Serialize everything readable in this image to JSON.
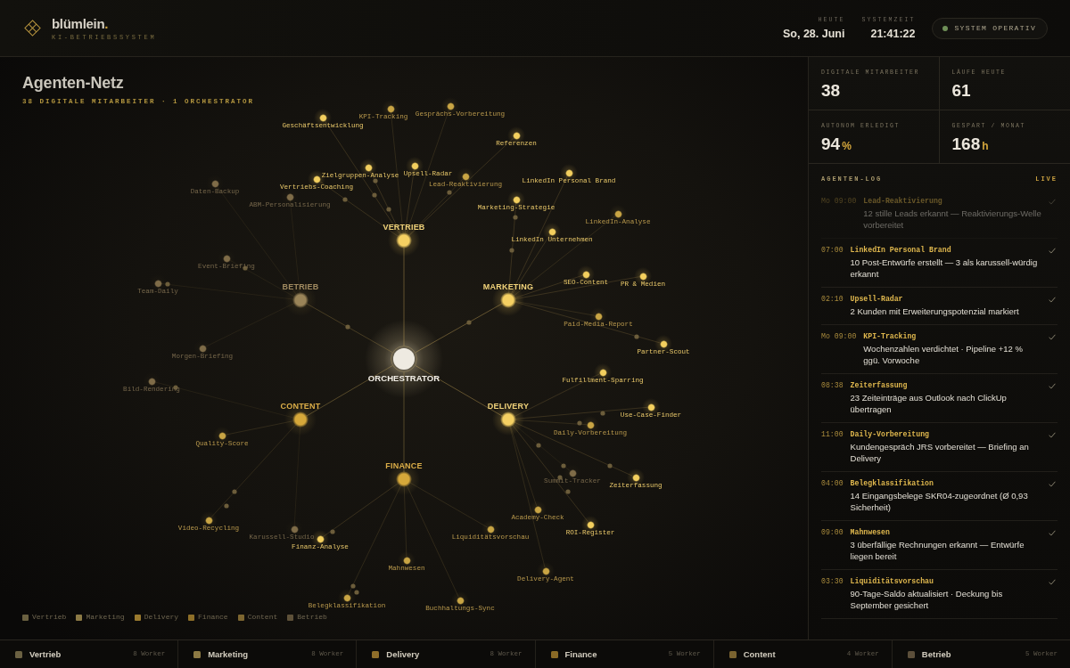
{
  "header": {
    "brand": {
      "name": "blümlein",
      "dot": "."
    },
    "tagline": "KI-BETRIEBSSYSTEM",
    "date_label": "HEUTE",
    "date": "So, 28. Juni",
    "time_label": "SYSTEMZEIT",
    "time": "21:41:22",
    "status": "SYSTEM OPERATIV"
  },
  "network": {
    "title": "Agenten-Netz",
    "subtitle": "38 DIGITALE MITARBEITER · 1 ORCHESTRATOR",
    "orchestrator": "ORCHESTRATOR",
    "hubs": [
      {
        "label": "VERTRIEB",
        "active": true,
        "dimmed": false,
        "agents": [
          {
            "label": "Geschäftsentwicklung",
            "active": true,
            "dimmed": false
          },
          {
            "label": "KPI-Tracking",
            "active": false,
            "dimmed": false
          },
          {
            "label": "Gesprächs-Vorbereitung",
            "active": false,
            "dimmed": false
          },
          {
            "label": "Referenzen",
            "active": true,
            "dimmed": false
          },
          {
            "label": "Zielgruppen-Analyse",
            "active": true,
            "dimmed": false
          },
          {
            "label": "Upsell-Radar",
            "active": true,
            "dimmed": false
          },
          {
            "label": "Vertriebs-Coaching",
            "active": true,
            "dimmed": false
          },
          {
            "label": "Lead-Reaktivierung",
            "active": false,
            "dimmed": false
          }
        ]
      },
      {
        "label": "BETRIEB",
        "active": false,
        "dimmed": true,
        "agents": [
          {
            "label": "Daten-Backup",
            "active": false,
            "dimmed": true
          },
          {
            "label": "ABM-Personalisierung",
            "active": false,
            "dimmed": true
          },
          {
            "label": "Event-Briefing",
            "active": false,
            "dimmed": true
          },
          {
            "label": "Team-Daily",
            "active": false,
            "dimmed": true
          },
          {
            "label": "Morgen-Briefing",
            "active": false,
            "dimmed": true
          }
        ]
      },
      {
        "label": "MARKETING",
        "active": true,
        "dimmed": false,
        "agents": [
          {
            "label": "LinkedIn Personal Brand",
            "active": true,
            "dimmed": false
          },
          {
            "label": "Marketing-Strategie",
            "active": true,
            "dimmed": false
          },
          {
            "label": "LinkedIn-Analyse",
            "active": false,
            "dimmed": false
          },
          {
            "label": "LinkedIn Unternehmen",
            "active": true,
            "dimmed": false
          },
          {
            "label": "SEO-Content",
            "active": true,
            "dimmed": false
          },
          {
            "label": "PR & Medien",
            "active": true,
            "dimmed": false
          },
          {
            "label": "Paid-Media-Report",
            "active": false,
            "dimmed": false
          },
          {
            "label": "Partner-Scout",
            "active": true,
            "dimmed": false
          }
        ]
      },
      {
        "label": "CONTENT",
        "active": false,
        "dimmed": false,
        "agents": [
          {
            "label": "Bild-Rendering",
            "active": false,
            "dimmed": true
          },
          {
            "label": "Quality-Score",
            "active": false,
            "dimmed": false
          },
          {
            "label": "Video-Recycling",
            "active": false,
            "dimmed": false
          },
          {
            "label": "Karussell-Studio",
            "active": false,
            "dimmed": true
          }
        ]
      },
      {
        "label": "DELIVERY",
        "active": true,
        "dimmed": false,
        "agents": [
          {
            "label": "Fulfillment-Sparring",
            "active": true,
            "dimmed": false
          },
          {
            "label": "Use-Case-Finder",
            "active": true,
            "dimmed": false
          },
          {
            "label": "Daily-Vorbereitung",
            "active": false,
            "dimmed": false
          },
          {
            "label": "Summit-Tracker",
            "active": false,
            "dimmed": true
          },
          {
            "label": "Zeiterfassung",
            "active": true,
            "dimmed": false
          },
          {
            "label": "Academy-Check",
            "active": false,
            "dimmed": false
          },
          {
            "label": "ROI-Register",
            "active": true,
            "dimmed": false
          },
          {
            "label": "Delivery-Agent",
            "active": false,
            "dimmed": false
          }
        ]
      },
      {
        "label": "FINANCE",
        "active": false,
        "dimmed": false,
        "agents": [
          {
            "label": "Liquiditätsvorschau",
            "active": false,
            "dimmed": false
          },
          {
            "label": "Finanz-Analyse",
            "active": true,
            "dimmed": false
          },
          {
            "label": "Mahnwesen",
            "active": false,
            "dimmed": false
          },
          {
            "label": "Buchhaltungs-Sync",
            "active": false,
            "dimmed": false
          },
          {
            "label": "Belegklassifikation",
            "active": false,
            "dimmed": false
          }
        ]
      }
    ]
  },
  "legend": [
    {
      "label": "Vertrieb",
      "color": "#6a6040"
    },
    {
      "label": "Marketing",
      "color": "#8c7a45"
    },
    {
      "label": "Delivery",
      "color": "#9a7a2e"
    },
    {
      "label": "Finance",
      "color": "#8e6f28"
    },
    {
      "label": "Content",
      "color": "#7d6630"
    },
    {
      "label": "Betrieb",
      "color": "#5e5139"
    }
  ],
  "stats": [
    {
      "label": "DIGITALE MITARBEITER",
      "value": "38"
    },
    {
      "label": "LÄUFE HEUTE",
      "value": "61"
    },
    {
      "label": "AUTONOM ERLEDIGT",
      "value": "94",
      "unit": "%"
    },
    {
      "label": "GESPART / MONAT",
      "value": "168",
      "unit": "h"
    }
  ],
  "log": {
    "title": "AGENTEN-LOG",
    "badge": "LIVE",
    "entries": [
      {
        "time": "Mo 09:00",
        "agent": "Lead-Reaktivierung",
        "message": "12 stille Leads erkannt — Reaktivierungs-Welle vorbereitet",
        "done": true,
        "faded": true
      },
      {
        "time": "07:00",
        "agent": "LinkedIn Personal Brand",
        "message": "10 Post-Entwürfe erstellt — 3 als karussell-würdig erkannt",
        "done": true,
        "faded": false
      },
      {
        "time": "02:10",
        "agent": "Upsell-Radar",
        "message": "2 Kunden mit Erweiterungspotenzial markiert",
        "done": true,
        "faded": false
      },
      {
        "time": "Mo 09:00",
        "agent": "KPI-Tracking",
        "message": "Wochenzahlen verdichtet · Pipeline +12 % ggü. Vorwoche",
        "done": true,
        "faded": false
      },
      {
        "time": "08:38",
        "agent": "Zeiterfassung",
        "message": "23 Zeiteinträge aus Outlook nach ClickUp übertragen",
        "done": true,
        "faded": false
      },
      {
        "time": "11:00",
        "agent": "Daily-Vorbereitung",
        "message": "Kundengespräch JRS vorbereitet — Briefing an Delivery",
        "done": true,
        "faded": false
      },
      {
        "time": "04:00",
        "agent": "Belegklassifikation",
        "message": "14 Eingangsbelege SKR04-zugeordnet (Ø 0,93 Sicherheit)",
        "done": true,
        "faded": false
      },
      {
        "time": "09:00",
        "agent": "Mahnwesen",
        "message": "3 überfällige Rechnungen erkannt — Entwürfe liegen bereit",
        "done": true,
        "faded": false
      },
      {
        "time": "03:30",
        "agent": "Liquiditätsvorschau",
        "message": "90-Tage-Saldo aktualisiert · Deckung bis September gesichert",
        "done": true,
        "faded": false
      }
    ]
  },
  "departments": [
    {
      "name": "Vertrieb",
      "color": "#6b6142",
      "workers": "8 Worker"
    },
    {
      "name": "Marketing",
      "color": "#8d7a44",
      "workers": "8 Worker"
    },
    {
      "name": "Delivery",
      "color": "#8f6e2a",
      "workers": "8 Worker"
    },
    {
      "name": "Finance",
      "color": "#8a6a26",
      "workers": "5 Worker"
    },
    {
      "name": "Content",
      "color": "#7a6330",
      "workers": "4 Worker"
    },
    {
      "name": "Betrieb",
      "color": "#5c4f3a",
      "workers": "5 Worker"
    }
  ]
}
